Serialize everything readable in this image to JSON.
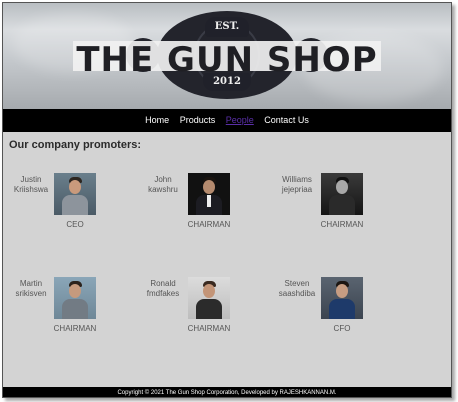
{
  "banner": {
    "badge_top": "EST.",
    "title": "THE GUN SHOP",
    "badge_bottom": "2012"
  },
  "nav": {
    "items": [
      {
        "label": "Home"
      },
      {
        "label": "Products"
      },
      {
        "label": "People"
      },
      {
        "label": "Contact Us"
      }
    ]
  },
  "main": {
    "heading": "Our company promoters:",
    "people": [
      {
        "name": "Justin Kriishswa",
        "role": "CEO"
      },
      {
        "name": "John kawshru",
        "role": "CHAIRMAN"
      },
      {
        "name": "Williams jejepriaa",
        "role": "CHAIRMAN"
      },
      {
        "name": "Martin srikisven",
        "role": "CHAIRMAN"
      },
      {
        "name": "Ronald fmdfakes",
        "role": "CHAIRMAN"
      },
      {
        "name": "Steven saashdiba",
        "role": "CFO"
      }
    ]
  },
  "footer": {
    "text": "Copyright © 2021 The Gun Shop Corporation, Developed by RAJESHKANNAN.M."
  },
  "colors": {
    "page_bg": "#d3d3d3",
    "nav_bg": "#000000",
    "visited_link": "#5a2fa8"
  }
}
